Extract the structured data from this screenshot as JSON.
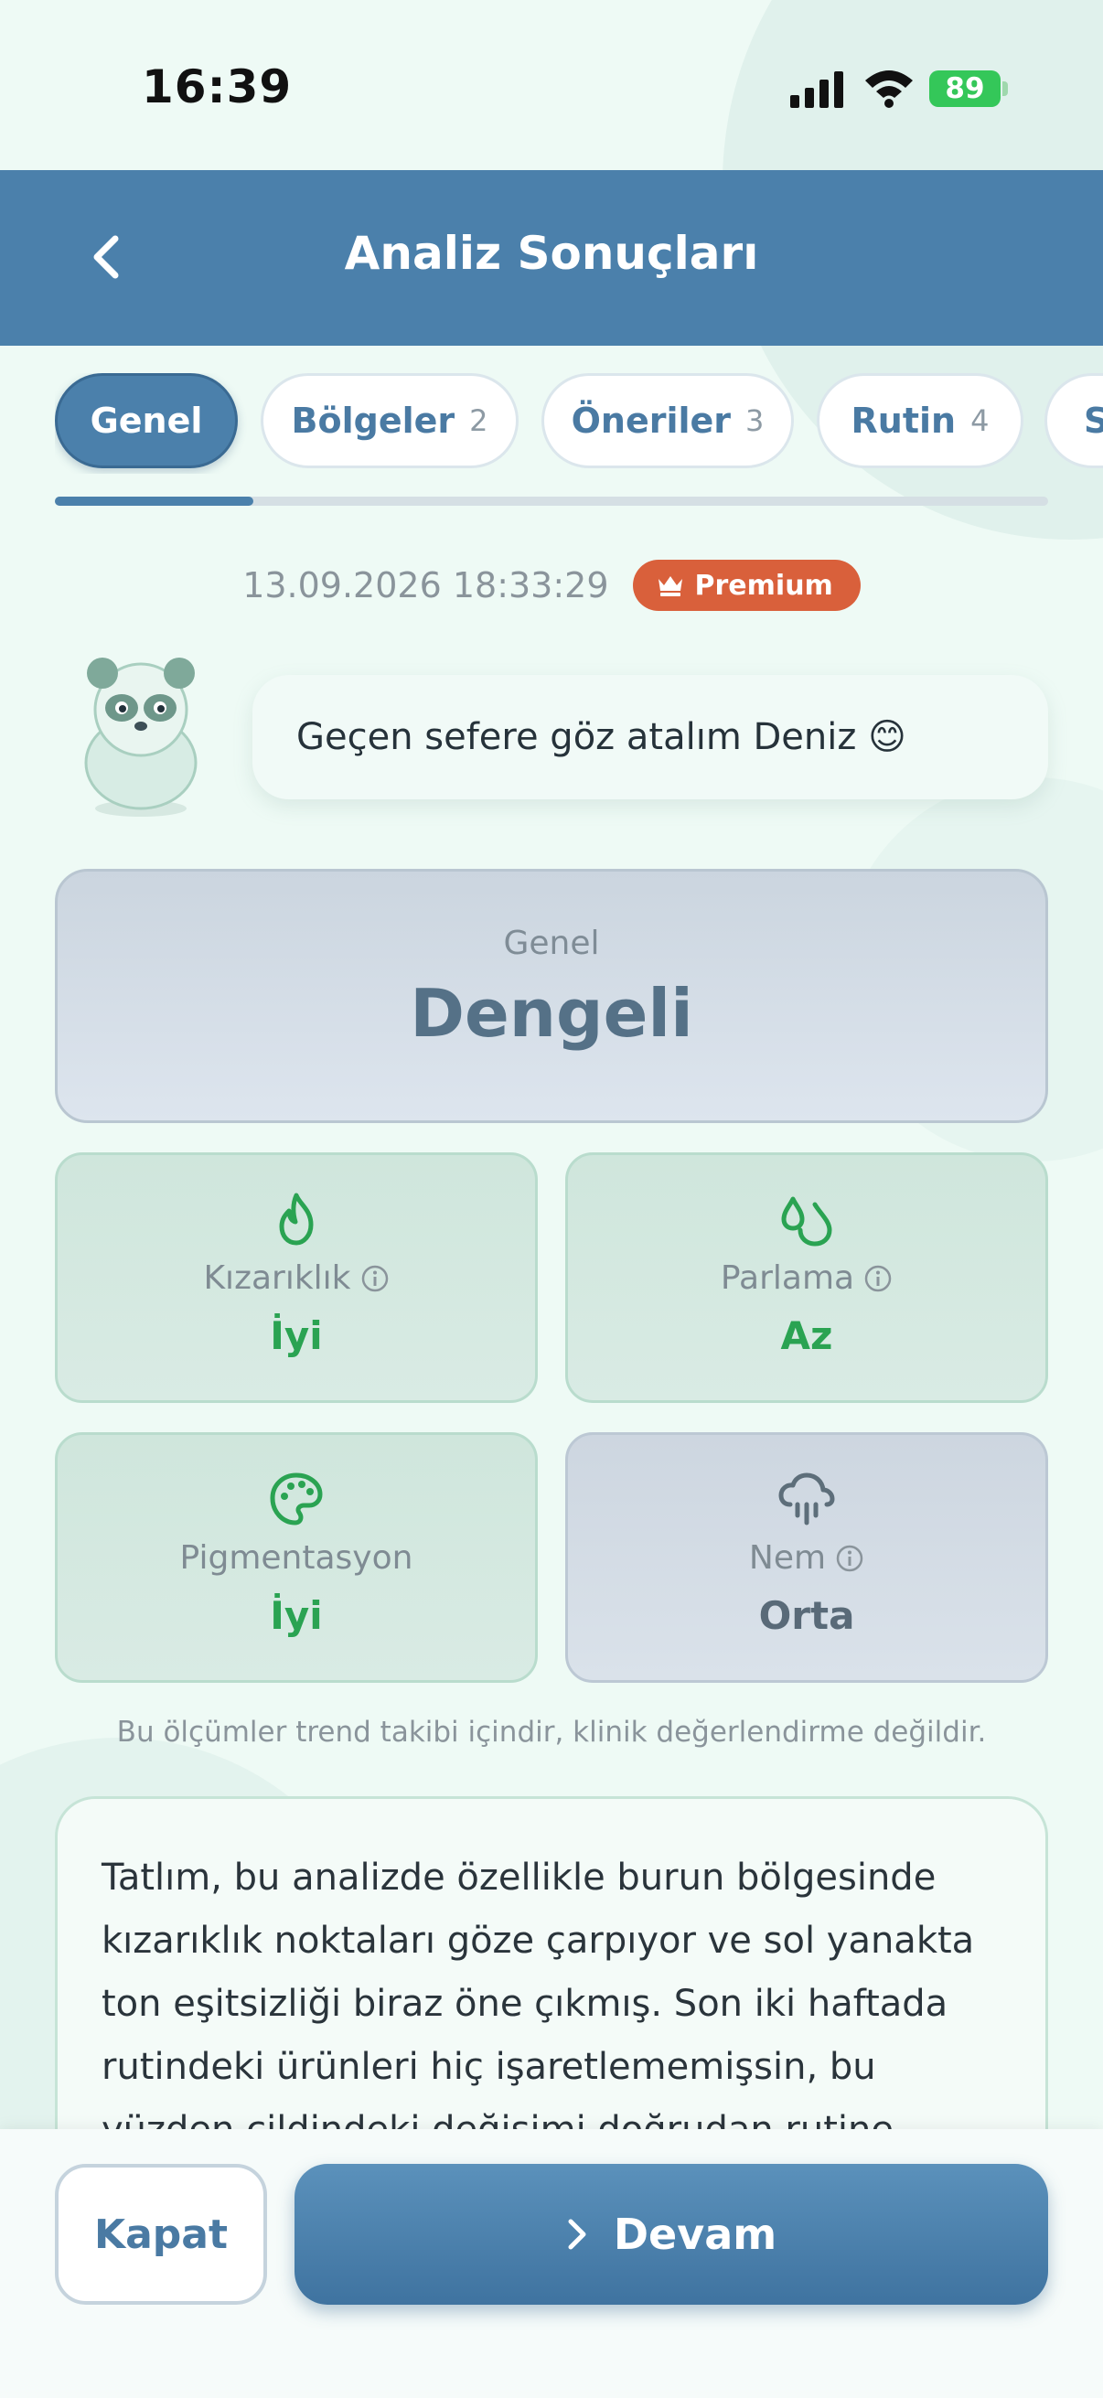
{
  "status_bar": {
    "time": "16:39",
    "battery": "89"
  },
  "header": {
    "title": "Analiz Sonuçları"
  },
  "tabs": [
    {
      "label": "Genel",
      "count": ""
    },
    {
      "label": "Bölgeler",
      "count": "2"
    },
    {
      "label": "Öneriler",
      "count": "3"
    },
    {
      "label": "Rutin",
      "count": "4"
    },
    {
      "label": "S",
      "count": ""
    }
  ],
  "tab_progress_fraction": 0.2,
  "meta": {
    "date": "13.09.2026 18:33:29",
    "badge": "Premium"
  },
  "greeting": {
    "text": "Geçen sefere göz atalım Deniz 😊"
  },
  "overall": {
    "label": "Genel",
    "value": "Dengeli"
  },
  "metrics": [
    {
      "label": "Kızarıklık",
      "value": "İyi",
      "icon": "flame-icon",
      "status": "good"
    },
    {
      "label": "Parlama",
      "value": "Az",
      "icon": "droplets-icon",
      "status": "good"
    },
    {
      "label": "Pigmentasyon",
      "value": "İyi",
      "icon": "palette-icon",
      "status": "good"
    },
    {
      "label": "Nem",
      "value": "Orta",
      "icon": "cloud-rain-icon",
      "status": "mid"
    }
  ],
  "disclaimer": "Bu ölçümler trend takibi içindir, klinik değerlendirme değildir.",
  "comment": {
    "text": "Tatlım, bu analizde özellikle burun bölgesinde kızarıklık noktaları göze çarpıyor ve sol yanakta ton eşitsizliği biraz öne çıkmış. Son iki haftada rutindeki ürünleri hiç işaretlememişsin, bu yüzden cildindeki değişimi doğrudan rutine"
  },
  "footer": {
    "close_label": "Kapat",
    "next_label": "Devam"
  },
  "colors": {
    "header": "#4b80ab",
    "good": "#2aa352",
    "premium": "#d9603b"
  }
}
